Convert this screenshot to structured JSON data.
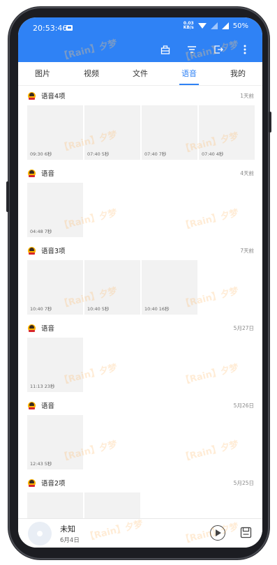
{
  "status_bar": {
    "time": "20:53:46",
    "net_speed_top": "0.03",
    "net_speed_bottom": "KB/s",
    "battery": "50%"
  },
  "toolbar": {
    "icons": [
      "grid-icon",
      "filter-icon",
      "export-icon",
      "more-icon"
    ]
  },
  "tabs": [
    {
      "label": "图片"
    },
    {
      "label": "视频"
    },
    {
      "label": "文件"
    },
    {
      "label": "语音",
      "active": true
    },
    {
      "label": "我的"
    }
  ],
  "groups": [
    {
      "title": "语音4项",
      "date": "1天前",
      "items": [
        {
          "meta": "09:30 6秒"
        },
        {
          "meta": "07:40 5秒"
        },
        {
          "meta": "07:40 7秒"
        },
        {
          "meta": "07:40 4秒"
        }
      ]
    },
    {
      "title": "语音",
      "date": "4天前",
      "items": [
        {
          "meta": "04:48 7秒"
        }
      ]
    },
    {
      "title": "语音3项",
      "date": "7天前",
      "items": [
        {
          "meta": "10:40 7秒"
        },
        {
          "meta": "10:40 5秒"
        },
        {
          "meta": "10:40 16秒"
        }
      ]
    },
    {
      "title": "语音",
      "date": "5月27日",
      "items": [
        {
          "meta": "11:13 23秒"
        }
      ]
    },
    {
      "title": "语音",
      "date": "5月26日",
      "items": [
        {
          "meta": "12:43 5秒"
        }
      ]
    },
    {
      "title": "语音2项",
      "date": "5月25日",
      "items": [
        {
          "meta": ""
        },
        {
          "meta": ""
        }
      ]
    }
  ],
  "player": {
    "title": "未知",
    "subtitle": "6月4日"
  },
  "watermark": "【Rain】夕梦",
  "colors": {
    "accent": "#2f82f5",
    "thumb_bg": "#f2f2f2"
  }
}
